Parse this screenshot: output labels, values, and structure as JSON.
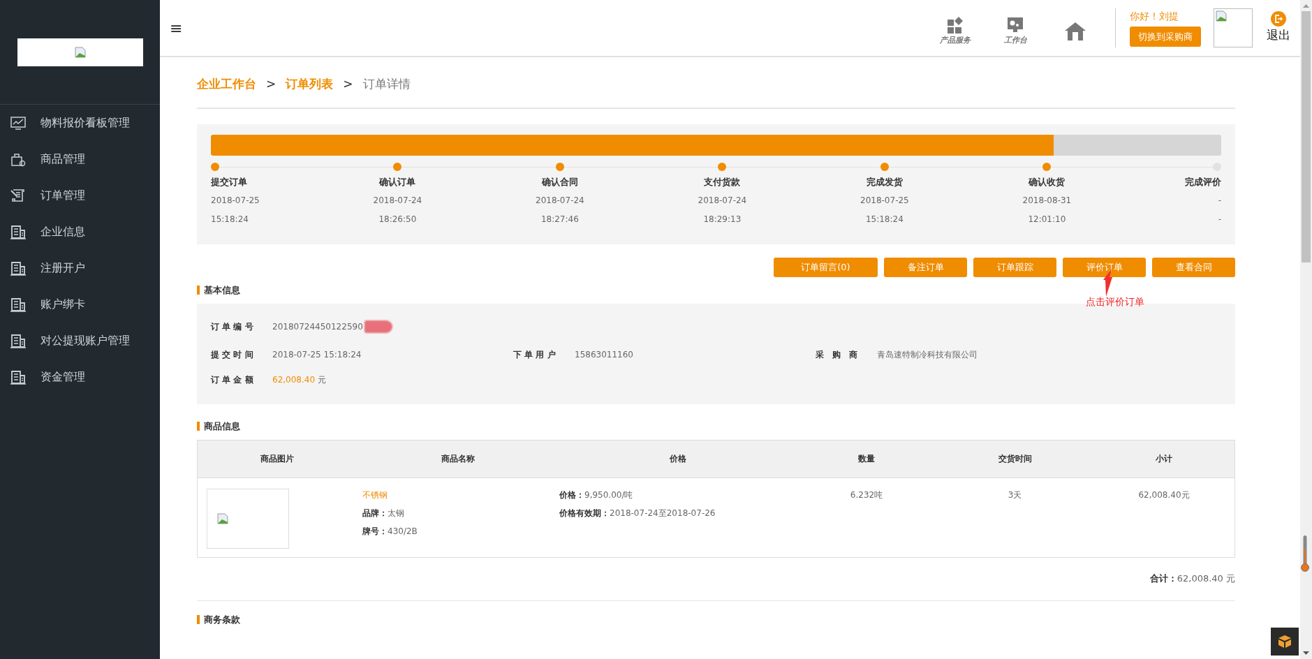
{
  "sidebar": {
    "items": [
      {
        "label": "物料报价看板管理"
      },
      {
        "label": "商品管理"
      },
      {
        "label": "订单管理"
      },
      {
        "label": "企业信息"
      },
      {
        "label": "注册开户"
      },
      {
        "label": "账户绑卡"
      },
      {
        "label": "对公提现账户管理"
      },
      {
        "label": "资金管理"
      }
    ]
  },
  "header": {
    "menu_glyph": "≡",
    "tools": [
      {
        "kind": "grid",
        "label": "产品服务"
      },
      {
        "kind": "desk",
        "label": "工作台"
      },
      {
        "kind": "house"
      }
    ],
    "greeting": "你好！刘提",
    "switch_button": "切换到采购商",
    "logout": "退出"
  },
  "breadcrumb": [
    {
      "label": "企业工作台",
      "current": false
    },
    {
      "sep": ">",
      "label": "订单列表",
      "current": false
    },
    {
      "sep": ">",
      "label": "订单详情",
      "current": true
    }
  ],
  "progress": {
    "level": 0.834,
    "steps": [
      {
        "label": "提交订单",
        "date": "2018-07-25",
        "time": "15:18:24",
        "done": true
      },
      {
        "label": "确认订单",
        "date": "2018-07-24",
        "time": "18:26:50",
        "done": true
      },
      {
        "label": "确认合同",
        "date": "2018-07-24",
        "time": "18:27:46",
        "done": true
      },
      {
        "label": "支付货款",
        "date": "2018-07-24",
        "time": "18:29:13",
        "done": true
      },
      {
        "label": "完成发货",
        "date": "2018-07-25",
        "time": "15:18:24",
        "done": true
      },
      {
        "label": "确认收货",
        "date": "2018-08-31",
        "time": "12:01:10",
        "done": true
      },
      {
        "label": "完成评价",
        "date": "-",
        "time": "-",
        "done": false
      }
    ]
  },
  "actions": [
    "订单留言(0)",
    "备注订单",
    "订单跟踪",
    "评价订单",
    "查看合同"
  ],
  "annotation": {
    "text": "点击评价订单"
  },
  "basic_info": {
    "title": "基本信息",
    "order_no": {
      "label": "订 单 编 号",
      "value": "20180724450122590"
    },
    "fields": [
      {
        "label": "提 交 时 间",
        "value": "2018-07-25 15:18:24"
      },
      {
        "label": "下 单 用 户",
        "value": "15863011160"
      },
      {
        "label": "采　购　商",
        "value": "青岛速特制冷科技有限公司"
      }
    ],
    "amount": {
      "label": "订 单 金 额",
      "value": "62,008.40",
      "unit": "元"
    }
  },
  "goods": {
    "title": "商品信息",
    "columns": [
      "商品图片",
      "商品名称",
      "价格",
      "数量",
      "交货时间",
      "小计"
    ],
    "rows": [
      {
        "name": "不锈钢",
        "brand_label": "品牌：",
        "brand": "太钢",
        "grade_label": "牌号：",
        "grade": "430/2B",
        "price_label": "价格：",
        "price": "9,950.00/吨",
        "validity_label": "价格有效期：",
        "validity": "2018-07-24至2018-07-26",
        "quantity": "6.232吨",
        "delivery": "3天",
        "subtotal": "62,008.40元"
      }
    ],
    "total_label": "合计：",
    "total": "62,008.40 元"
  },
  "terms": {
    "title": "商务条款"
  }
}
